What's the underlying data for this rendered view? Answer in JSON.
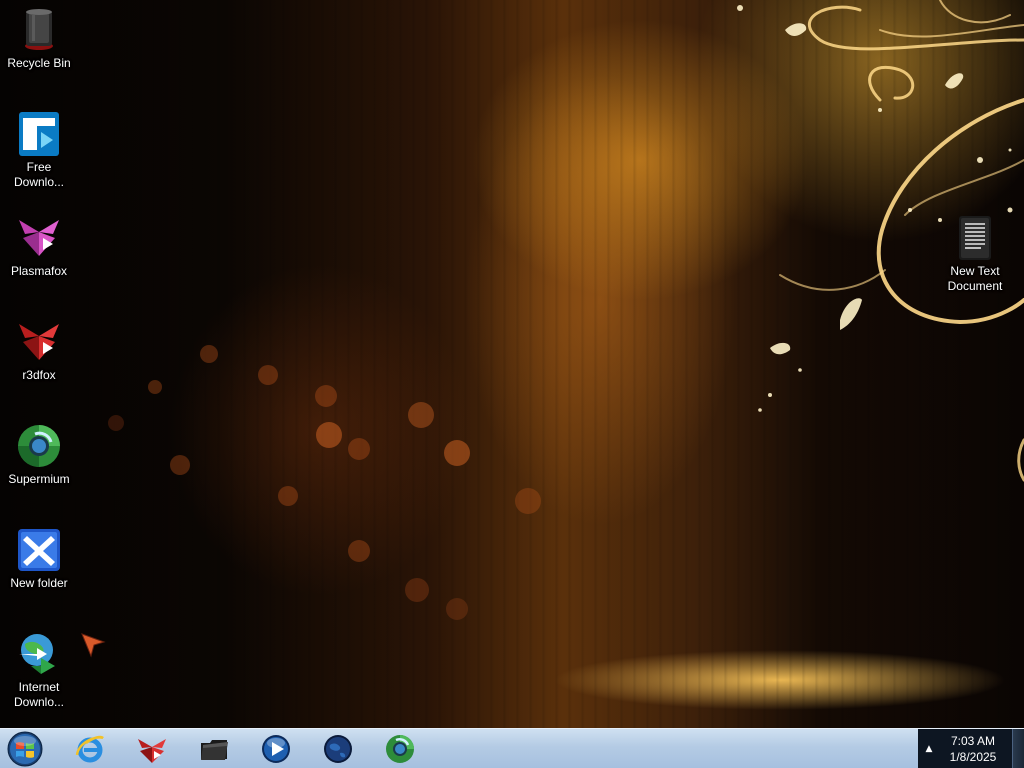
{
  "desktop": {
    "icons_left": [
      {
        "id": "recycle-bin",
        "label": "Recycle Bin"
      },
      {
        "id": "free-download-manager",
        "label": "Free\nDownlo..."
      },
      {
        "id": "plasmafox",
        "label": "Plasmafox"
      },
      {
        "id": "r3dfox",
        "label": "r3dfox"
      },
      {
        "id": "supermium",
        "label": "Supermium"
      },
      {
        "id": "new-folder",
        "label": "New folder"
      },
      {
        "id": "internet-download-manager",
        "label": "Internet\nDownlo..."
      }
    ],
    "icons_right": [
      {
        "id": "new-text-document",
        "label": "New Text\nDocument"
      }
    ]
  },
  "taskbar": {
    "start_icon": "windows-start-orb",
    "pinned": [
      {
        "id": "internet-explorer",
        "icon": "internet-explorer-icon"
      },
      {
        "id": "r3dfox",
        "icon": "r3dfox-icon"
      },
      {
        "id": "file-explorer",
        "icon": "folder-icon"
      },
      {
        "id": "media-player",
        "icon": "media-player-icon"
      },
      {
        "id": "globe-browser",
        "icon": "globe-icon"
      },
      {
        "id": "supermium",
        "icon": "supermium-icon"
      }
    ],
    "tray": {
      "overflow_icon": "▲",
      "time": "7:03 AM",
      "date": "1/8/2025"
    }
  },
  "colors": {
    "taskbar": "#b4cbe4",
    "tray": "#0d1622",
    "wallpaper_glow": "#ffb030"
  }
}
